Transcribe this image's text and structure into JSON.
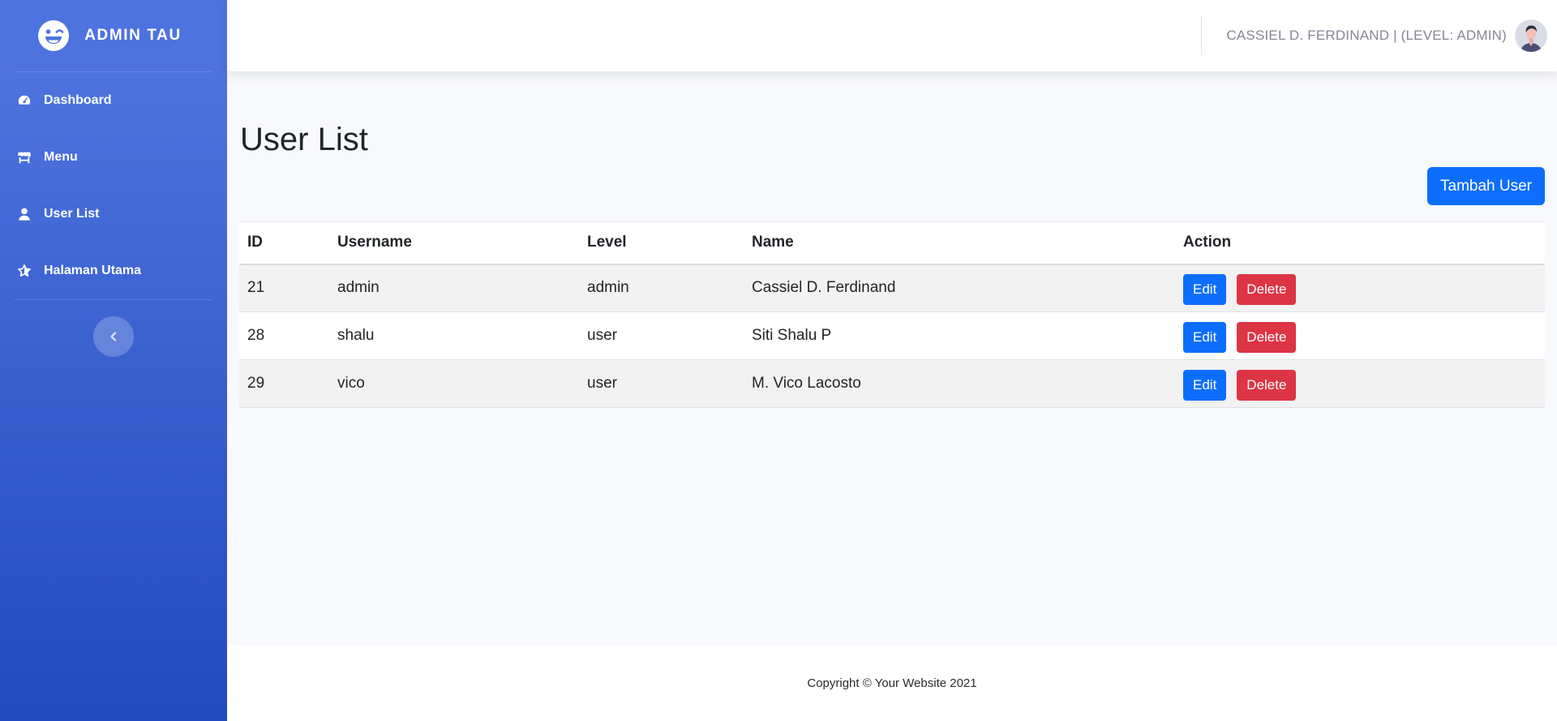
{
  "brand": {
    "name": "ADMIN TAU",
    "icon": "laugh-wink-icon"
  },
  "sidebar": {
    "items": [
      {
        "label": "Dashboard",
        "icon": "tachometer-icon"
      },
      {
        "label": "Menu",
        "icon": "store-icon"
      },
      {
        "label": "User List",
        "icon": "user-icon"
      },
      {
        "label": "Halaman Utama",
        "icon": "star-icon"
      }
    ],
    "toggle_icon": "chevron-left-icon"
  },
  "topbar": {
    "user_label": "CASSIEL D. FERDINAND | (LEVEL: ADMIN)"
  },
  "main": {
    "title": "User List",
    "add_button": "Tambah User",
    "table": {
      "headers": [
        "ID",
        "Username",
        "Level",
        "Name",
        "Action"
      ],
      "rows": [
        {
          "id": "21",
          "username": "admin",
          "level": "admin",
          "name": "Cassiel D. Ferdinand"
        },
        {
          "id": "28",
          "username": "shalu",
          "level": "user",
          "name": "Siti Shalu P"
        },
        {
          "id": "29",
          "username": "vico",
          "level": "user",
          "name": "M. Vico Lacosto"
        }
      ],
      "edit_label": "Edit",
      "delete_label": "Delete"
    }
  },
  "footer": {
    "text": "Copyright © Your Website 2021"
  },
  "colors": {
    "sidebar_top": "#4e73df",
    "sidebar_bottom": "#224abe",
    "primary": "#0d6efd",
    "danger": "#dc3545"
  }
}
